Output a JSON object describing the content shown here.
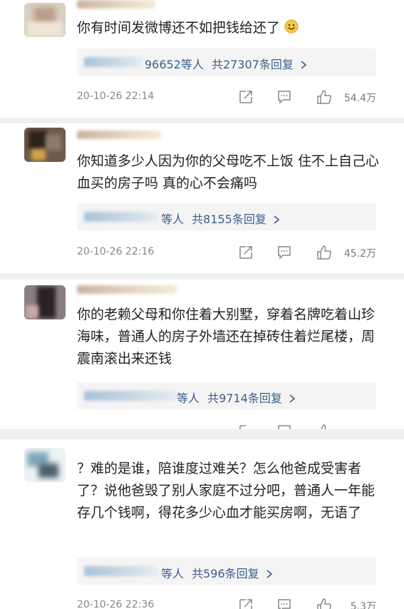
{
  "comments": [
    {
      "text": "你有时间发微博还不如把钱给还了",
      "emoji": "grinning-face-emoji",
      "replies_tail": "96652等人",
      "replies_total": "共27307条回复",
      "time": "20-10-26 22:14",
      "likes": "54.4万"
    },
    {
      "text": "你知道多少人因为你的父母吃不上饭 住不上自己心血买的房子吗 真的心不会痛吗",
      "replies_tail": "等人",
      "replies_total": "共8155条回复",
      "time": "20-10-26 22:16",
      "likes": "45.2万"
    },
    {
      "text": "你的老赖父母和你住着大别墅，穿着名牌吃着山珍海味，普通人的房子外墙还在掉砖住着烂尾楼，周震南滚出来还钱",
      "replies_tail": "等人",
      "replies_total": "共9714条回复"
    },
    {
      "text": "？难的是谁，陪谁度过难关？怎么他爸成受害者了？说他爸毁了别人家庭不过分吧，普通人一年能存几个钱啊，得花多少心血才能买房啊，无语了",
      "replies_tail": "等人",
      "replies_total": "共596条回复",
      "time": "20-10-26 22:36",
      "likes": "5.3万"
    }
  ],
  "icons": {
    "share": "share-icon",
    "comment": "comment-icon",
    "like": "thumbs-up-icon",
    "chevron": "chevron-right-icon"
  },
  "colors": {
    "reply_link": "#3a5f8c",
    "meta_text": "#888888",
    "page_background": "#f0f0f0"
  }
}
